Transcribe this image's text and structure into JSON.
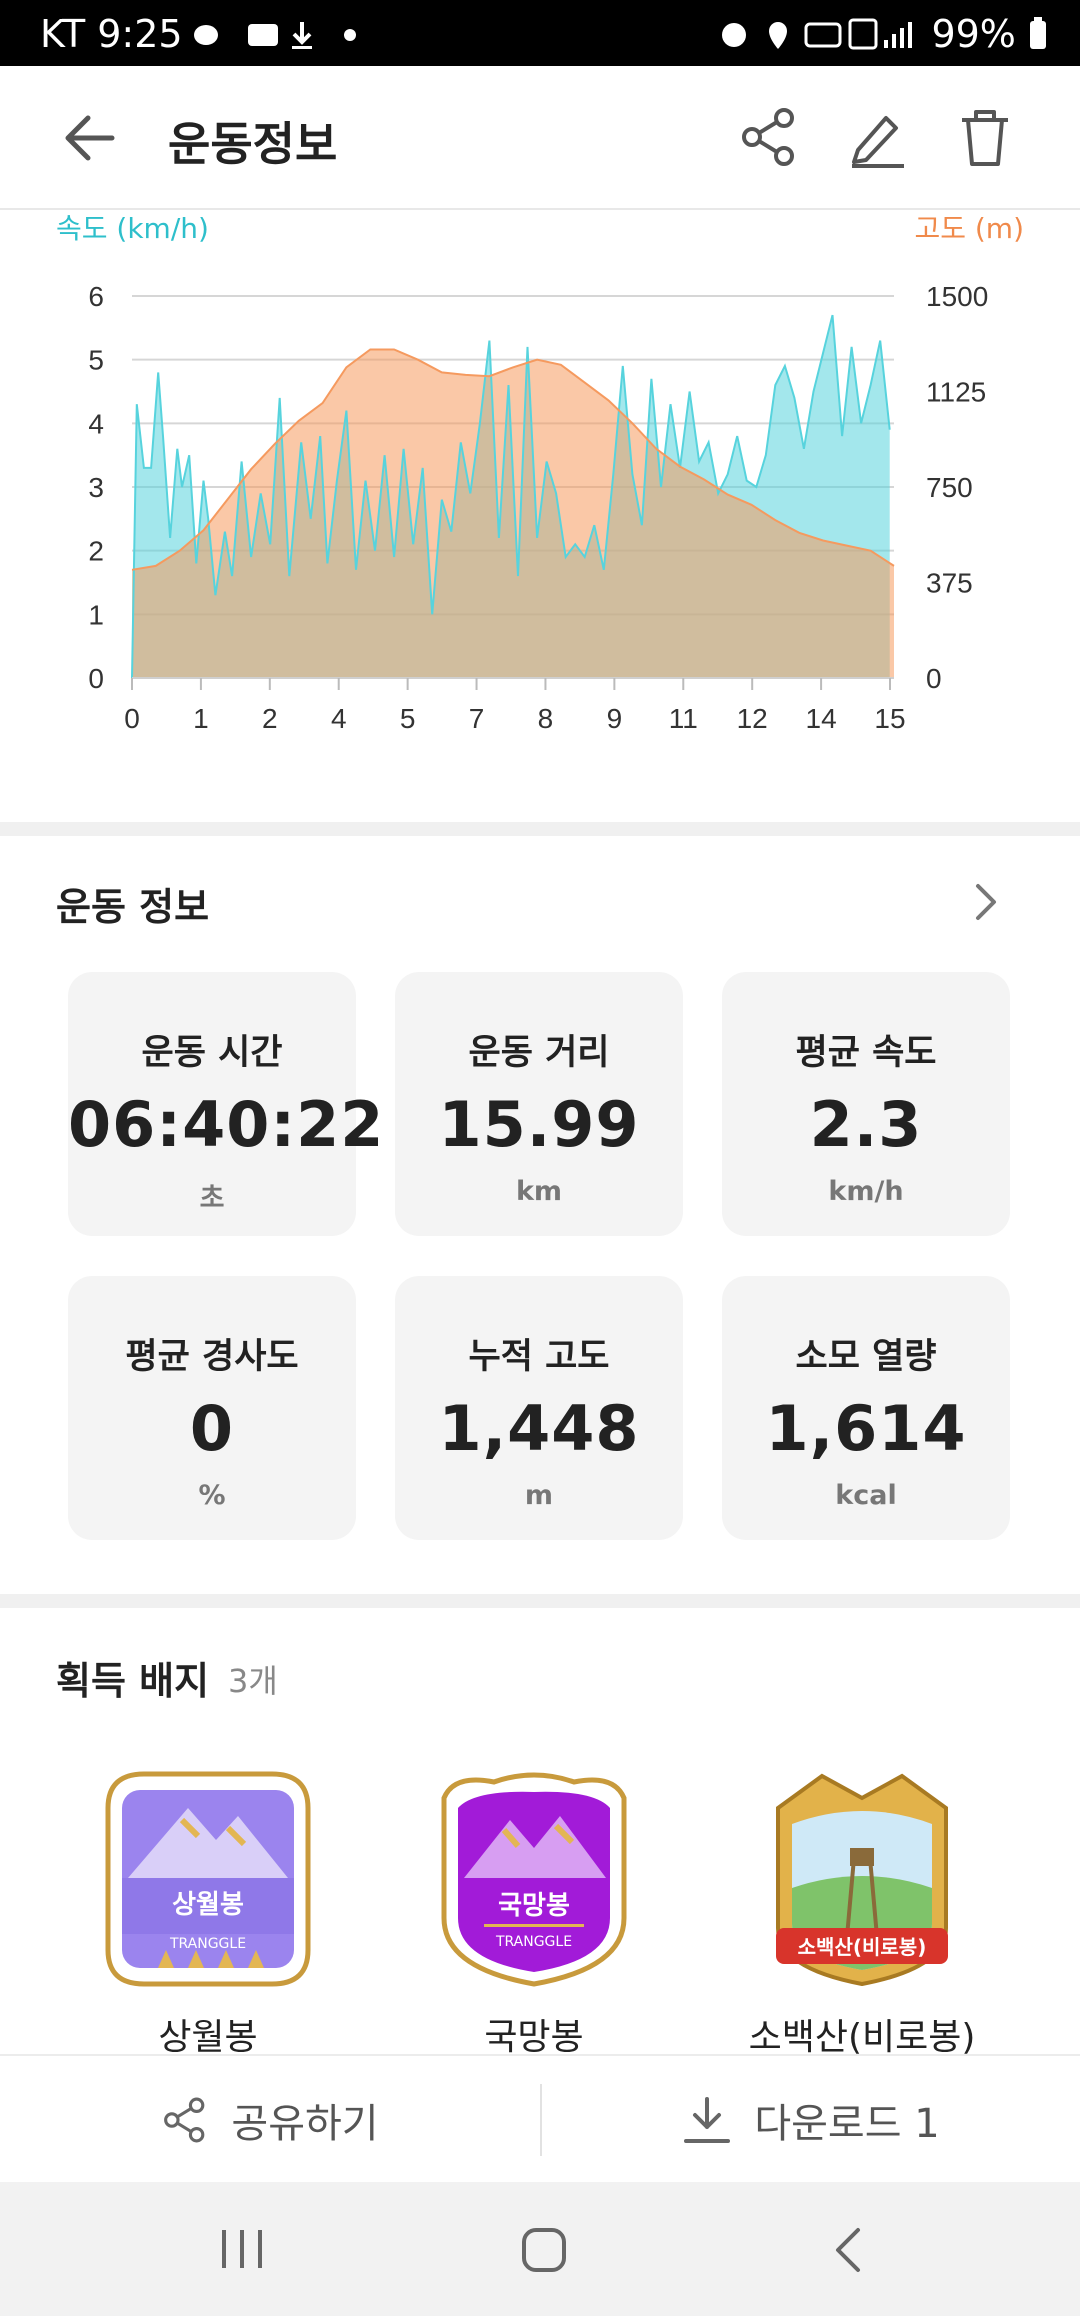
{
  "status_bar": {
    "carrier_time": "KT 9:25",
    "battery": "99%"
  },
  "header": {
    "title": "운동정보",
    "icons": [
      "arrow-left-icon",
      "share-icon",
      "edit-icon",
      "trash-icon"
    ]
  },
  "chart_data": {
    "type": "area",
    "left_axis_label": "속도 (km/h)",
    "right_axis_label": "고도 (m)",
    "x_ticks": [
      "0",
      "1",
      "2",
      "4",
      "5",
      "7",
      "8",
      "9",
      "11",
      "12",
      "14",
      "15"
    ],
    "y_left_ticks": [
      "0",
      "1",
      "2",
      "3",
      "4",
      "5",
      "6"
    ],
    "y_right_ticks": [
      "0",
      "375",
      "750",
      "1125",
      "1500"
    ],
    "ylim_left": [
      0,
      6
    ],
    "ylim_right": [
      0,
      1500
    ],
    "xlim": [
      0,
      15.99
    ],
    "colors": {
      "speed": "#57d3dd",
      "elevation": "#f59a5f",
      "left_label": "#2ebfcb",
      "right_label": "#f08a4b"
    },
    "series": [
      {
        "name": "속도 (km/h)",
        "x": [
          0,
          0.1,
          0.25,
          0.4,
          0.55,
          0.65,
          0.8,
          0.95,
          1.05,
          1.2,
          1.35,
          1.5,
          1.6,
          1.75,
          1.95,
          2.1,
          2.3,
          2.5,
          2.7,
          2.9,
          3.1,
          3.3,
          3.55,
          3.75,
          3.95,
          4.1,
          4.3,
          4.5,
          4.7,
          4.9,
          5.1,
          5.3,
          5.5,
          5.7,
          5.9,
          6.1,
          6.3,
          6.5,
          6.7,
          6.9,
          7.1,
          7.3,
          7.5,
          7.7,
          7.9,
          8.1,
          8.3,
          8.5,
          8.7,
          8.9,
          9.1,
          9.3,
          9.5,
          9.7,
          9.9,
          10.1,
          10.3,
          10.5,
          10.7,
          10.9,
          11.1,
          11.3,
          11.5,
          11.7,
          11.9,
          12.1,
          12.3,
          12.5,
          12.7,
          12.9,
          13.1,
          13.3,
          13.5,
          13.7,
          13.9,
          14.1,
          14.3,
          14.5,
          14.7,
          14.9,
          15.1,
          15.3,
          15.5,
          15.7,
          15.9
        ],
        "values": [
          0,
          4.3,
          3.3,
          3.3,
          4.8,
          3.8,
          2.2,
          3.6,
          3.0,
          3.5,
          1.8,
          3.1,
          2.5,
          1.3,
          2.3,
          1.6,
          3.4,
          1.9,
          2.9,
          2.1,
          4.4,
          1.6,
          3.7,
          2.5,
          3.8,
          1.8,
          3.1,
          4.2,
          1.7,
          3.1,
          2.0,
          3.5,
          1.9,
          3.6,
          2.1,
          3.3,
          1.0,
          2.8,
          2.3,
          3.7,
          2.9,
          4.0,
          5.3,
          2.2,
          4.6,
          1.6,
          5.2,
          2.2,
          3.4,
          2.9,
          1.9,
          2.1,
          1.9,
          2.4,
          1.7,
          3.2,
          4.9,
          3.2,
          2.4,
          4.7,
          3.0,
          4.3,
          3.3,
          4.5,
          3.4,
          3.7,
          2.9,
          3.2,
          3.8,
          3.1,
          3.0,
          3.5,
          4.6,
          4.9,
          4.4,
          3.6,
          4.5,
          5.1,
          5.7,
          3.8,
          5.2,
          4.0,
          4.6,
          5.3,
          3.9
        ],
        "color": "#57d3dd"
      },
      {
        "name": "고도 (m)",
        "x": [
          0,
          0.5,
          1.0,
          1.5,
          2.0,
          2.5,
          3.0,
          3.5,
          4.0,
          4.5,
          5.0,
          5.5,
          6.0,
          6.5,
          7.0,
          7.5,
          8.0,
          8.5,
          9.0,
          9.5,
          10.0,
          10.5,
          11.0,
          11.5,
          12.0,
          12.5,
          13.0,
          13.5,
          14.0,
          14.5,
          15.0,
          15.5,
          15.99
        ],
        "values": [
          425,
          440,
          500,
          580,
          700,
          820,
          920,
          1010,
          1080,
          1220,
          1290,
          1290,
          1250,
          1200,
          1190,
          1185,
          1220,
          1250,
          1230,
          1160,
          1090,
          1000,
          900,
          830,
          780,
          720,
          680,
          620,
          570,
          540,
          520,
          500,
          440
        ],
        "color": "#f59a5f"
      }
    ]
  },
  "exercise_info": {
    "title": "운동 정보",
    "stats": [
      {
        "label": "운동 시간",
        "value": "06:40:22",
        "unit": "초"
      },
      {
        "label": "운동 거리",
        "value": "15.99",
        "unit": "km"
      },
      {
        "label": "평균 속도",
        "value": "2.3",
        "unit": "km/h"
      },
      {
        "label": "평균 경사도",
        "value": "0",
        "unit": "%"
      },
      {
        "label": "누적 고도",
        "value": "1,448",
        "unit": "m"
      },
      {
        "label": "소모 열량",
        "value": "1,614",
        "unit": "kcal"
      }
    ]
  },
  "badges": {
    "title": "획득 배지",
    "count": "3개",
    "items": [
      {
        "name": "상월봉",
        "badge_text": "상월봉",
        "sub_text": "TRANGGLE",
        "color": "#9b84ee"
      },
      {
        "name": "국망봉",
        "badge_text": "국망봉",
        "sub_text": "TRANGGLE",
        "color": "#a21bd8"
      },
      {
        "name": "소백산(비로봉)",
        "badge_text": "소백산(비로봉)",
        "sub_text": "",
        "color": "#d8342b"
      }
    ]
  },
  "bottom_bar": {
    "share_label": "공유하기",
    "download_label": "다운로드 1"
  }
}
